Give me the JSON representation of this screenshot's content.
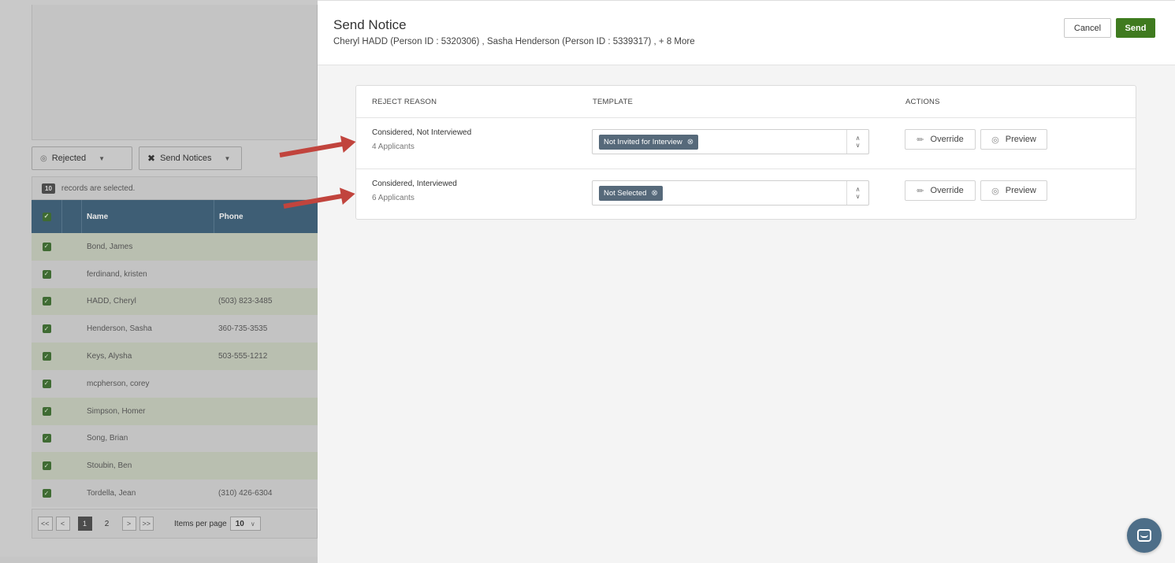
{
  "left": {
    "filters": {
      "rejected_label": "Rejected",
      "send_notices_label": "Send Notices"
    },
    "selection": {
      "count": "10",
      "text": "records are selected."
    },
    "grid": {
      "headers": {
        "name": "Name",
        "phone": "Phone"
      },
      "rows": [
        {
          "name": "Bond, James",
          "phone": ""
        },
        {
          "name": "ferdinand, kristen",
          "phone": ""
        },
        {
          "name": "HADD, Cheryl",
          "phone": "(503) 823-3485"
        },
        {
          "name": "Henderson, Sasha",
          "phone": "360-735-3535"
        },
        {
          "name": "Keys, Alysha",
          "phone": "503-555-1212"
        },
        {
          "name": "mcpherson, corey",
          "phone": ""
        },
        {
          "name": "Simpson, Homer",
          "phone": ""
        },
        {
          "name": "Song, Brian",
          "phone": ""
        },
        {
          "name": "Stoubin, Ben",
          "phone": ""
        },
        {
          "name": "Tordella, Jean",
          "phone": "(310) 426-6304"
        }
      ]
    },
    "pager": {
      "first": "<<",
      "prev": "<",
      "current_page": "1",
      "page_2": "2",
      "next": ">",
      "last": ">>",
      "items_per_page_label": "Items per page",
      "items_per_page_value": "10"
    }
  },
  "panel": {
    "title": "Send Notice",
    "subtitle": "Cheryl HADD (Person ID : 5320306) , Sasha Henderson (Person ID : 5339317) , + 8 More",
    "cancel_label": "Cancel",
    "send_label": "Send",
    "table": {
      "headers": {
        "reason": "REJECT REASON",
        "template": "TEMPLATE",
        "actions": "ACTIONS"
      },
      "rows": [
        {
          "reason": "Considered, Not Interviewed",
          "count": "4 Applicants",
          "template": "Not Invited for Interview",
          "override_label": "Override",
          "preview_label": "Preview"
        },
        {
          "reason": "Considered, Interviewed",
          "count": "6 Applicants",
          "template": "Not Selected",
          "override_label": "Override",
          "preview_label": "Preview"
        }
      ]
    }
  },
  "colors": {
    "send_button": "#3f7a1f",
    "grid_header": "#3e5e75",
    "template_tag": "#56697a",
    "annotation_arrow": "#c1443d",
    "chat_launcher": "#4d6e88"
  },
  "icons": {
    "eye": "eye-icon",
    "runner": "running-person-icon",
    "pencil": "pencil-icon",
    "remove": "circle-x-icon",
    "chat": "chat-bubble-icon"
  }
}
